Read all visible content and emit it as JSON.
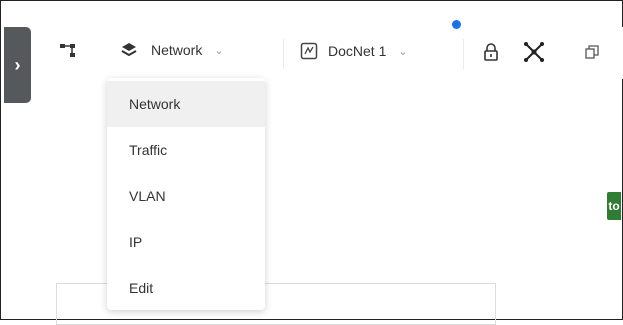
{
  "toolbar": {
    "side_toggle_glyph": "›",
    "view_selector": {
      "selected": "Network",
      "icon": "layers-icon"
    },
    "doc_selector": {
      "selected": "DocNet 1",
      "icon": "document-icon"
    },
    "icons": [
      "topology-icon",
      "lock-icon",
      "expand-nodes-icon",
      "copy-icon"
    ]
  },
  "view_dropdown": {
    "items": [
      {
        "label": "Network",
        "selected": true
      },
      {
        "label": "Traffic",
        "selected": false
      },
      {
        "label": "VLAN",
        "selected": false
      },
      {
        "label": "IP",
        "selected": false
      },
      {
        "label": "Edit",
        "selected": false
      }
    ]
  },
  "badge": {
    "text": "to"
  },
  "colors": {
    "accent_dot": "#1a73e8",
    "badge_green": "#2e7d32",
    "side_toggle": "#55595c"
  }
}
